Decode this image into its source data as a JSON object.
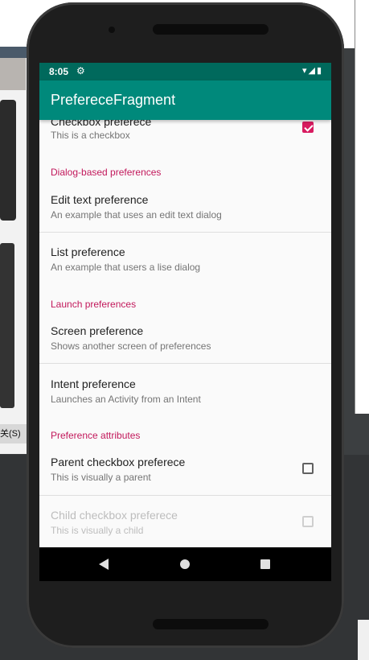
{
  "background": {
    "left_window_button": "关(S)"
  },
  "status_bar": {
    "time": "8:05",
    "settings_icon": "gear-icon",
    "right_icons": "wifi-icon signal-icon battery-icon"
  },
  "app_bar": {
    "title": "PreferecеFragment"
  },
  "preferences": {
    "checkbox": {
      "title": "Checkbox preferece",
      "summary": "This is a checkbox",
      "checked": true
    },
    "category_dialog": "Dialog-based preferences",
    "edit_text": {
      "title": "Edit text preference",
      "summary": "An example that uses an edit text dialog"
    },
    "list": {
      "title": "List preference",
      "summary": "An example that users a lise dialog"
    },
    "category_launch": "Launch preferences",
    "screen": {
      "title": "Screen preference",
      "summary": "Shows another screen of preferences"
    },
    "intent": {
      "title": "Intent preference",
      "summary": "Launches an Activity from an Intent"
    },
    "category_attributes": "Preference attributes",
    "parent_checkbox": {
      "title": "Parent checkbox preferece",
      "summary": "This is visually a parent",
      "checked": false
    },
    "child_checkbox": {
      "title": "Child checkbox preferece",
      "summary": "This is visually a child",
      "checked": false,
      "enabled": false
    }
  },
  "colors": {
    "status_bar": "#00695c",
    "app_bar": "#00897b",
    "accent": "#d81b60",
    "category_text": "#c2185b"
  }
}
